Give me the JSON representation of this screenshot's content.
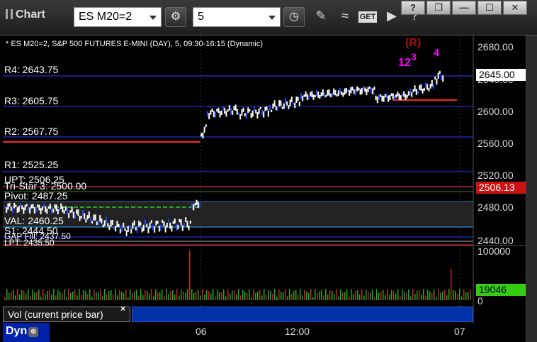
{
  "toolbar": {
    "title": "Chart",
    "symbol": "ES M20=2",
    "interval": "5",
    "icons": [
      "settings-gear-icon",
      "clock-icon",
      "pencil-icon",
      "indicator-icon",
      "get-icon",
      "play-icon",
      "help-icon",
      "restore-icon",
      "minimize-icon",
      "maximize-icon",
      "close-icon"
    ],
    "window_buttons": {
      "help": "?",
      "restore": "❐",
      "minimize": "—",
      "maximize": "☐",
      "close": "✕"
    }
  },
  "chart": {
    "title": "* ES M20=2, S&P 500 FUTURES E-MINI (DAY), 5, 09:30-16:15 (Dynamic)",
    "y_labels": [
      "2680.00",
      "2640.00",
      "2600.00",
      "2560.00",
      "2520.00",
      "2480.00",
      "2440.00"
    ],
    "last_price": "2645.00",
    "tri_star_price": "2506.13",
    "levels": {
      "r4": "R4: 2643.75",
      "r3": "R3: 2605.75",
      "r2": "R2: 2567.75",
      "r1": "R1: 2525.25",
      "upt": "UPT: 2506.25",
      "tri_star": "Tri-Star 3: 2500.00",
      "pivot": "Pivot: 2487.25",
      "val": "VAL: 2460.25",
      "s1": "S1: 2444.50",
      "gap": "GAP Fill: 2437.50",
      "lpt": "LPT: 2435.50"
    },
    "markers": {
      "r": "(R)",
      "n12": "12",
      "n3": "3",
      "n4": "4"
    },
    "colors": {
      "price": "#ffffff",
      "down": "#2244ff",
      "resistance": "#ff2222",
      "level_line": "#2a3aff",
      "marker_magenta": "#ff00ff",
      "marker_green": "#22aa22",
      "marker_r": "#aa0000"
    }
  },
  "volume": {
    "label": "Vol (current price bar)",
    "close_x": "×",
    "y_labels": [
      "100000",
      "0"
    ],
    "current": "19046"
  },
  "x_axis": {
    "labels": [
      "06",
      "12:00",
      "07"
    ]
  },
  "bottom": {
    "dyn_label": "Dyn"
  }
}
